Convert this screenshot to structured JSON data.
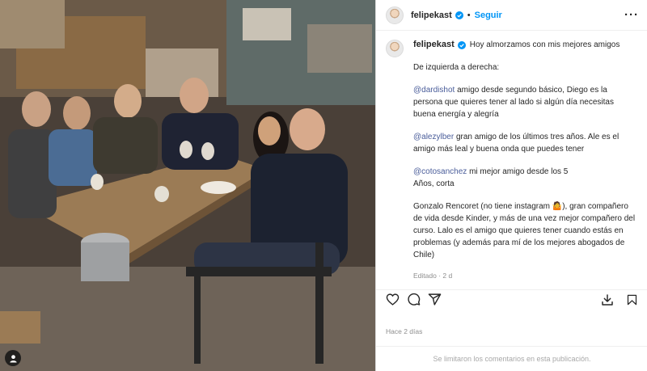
{
  "post": {
    "username": "felipekast",
    "follow_label": "Seguir",
    "separator": "•",
    "more_label": "···"
  },
  "caption": {
    "first_line": "Hoy almorzamos con mis mejores amigos",
    "intro": "De izquierda a derecha:",
    "p1_mention": "@dardishot",
    "p1_text": " amigo desde segundo básico, Diego es la persona que quieres tener al lado si algún día necesitas buena energía y alegría",
    "p2_mention": "@alezylber",
    "p2_text": " gran amigo de los últimos tres años. Ale es el amigo más leal y buena onda que puedes tener",
    "p3_mention": "@cotosanchez",
    "p3_text_line1": " mi mejor amigo desde los 5",
    "p3_text_line2": "Años, corta",
    "p4_text": "Gonzalo Rencoret (no tiene instagram 🤷), gran compañero de vida desde Kinder, y más de una vez mejor compañero del curso. Lalo es el amigo que quieres tener cuando estás en problemas (y además para mí de los mejores abogados de Chile)",
    "meta": "Editado · 2 d"
  },
  "footer": {
    "timestamp": "Hace 2 días",
    "comments_disabled": "Se limitaron los comentarios en esta publicación."
  },
  "icons": {
    "verified": "verified-badge-icon",
    "like": "heart-icon",
    "comment": "comment-icon",
    "share": "send-icon",
    "save": "bookmark-icon",
    "download": "download-icon",
    "tag": "person-tag-icon"
  },
  "colors": {
    "link": "#0095f6",
    "muted": "#8e8e8e",
    "text": "#262626"
  }
}
